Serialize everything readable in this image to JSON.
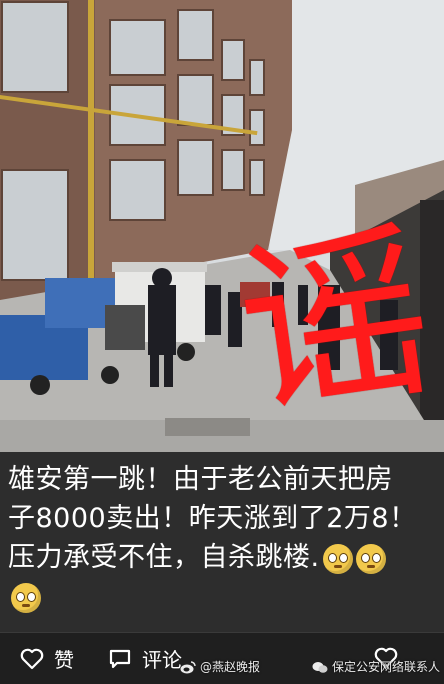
{
  "post": {
    "stamp_text": "谣",
    "caption": {
      "line1": "雄安第一跳！由于老公前天把房",
      "line2": "子8000卖出！昨天涨到了2万8！",
      "line3": "压力承受不住，自杀跳楼."
    },
    "emoji_names": [
      "pleading-face-icon",
      "pleading-face-icon",
      "pleading-face-icon"
    ]
  },
  "actions": {
    "like_label": "赞",
    "comment_label": "评论"
  },
  "watermarks": {
    "weibo_handle": "@燕赵晚报",
    "wechat_account": "保定公安网络联系人"
  },
  "colors": {
    "stamp_red": "#ff1b1b",
    "caption_bg": "#2d2d2d",
    "bar_bg": "#1f1f1f"
  }
}
